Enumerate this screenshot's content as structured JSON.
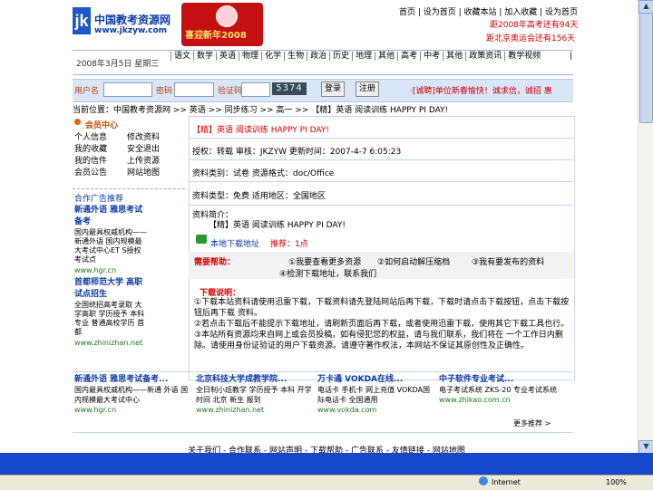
{
  "header": {
    "logo_mark": "jk",
    "logo_cn": "中国教考资源网",
    "logo_url": "www.jkzyw.com",
    "banner_text": "喜迎新年2008",
    "top_links": "首页 | 设为首页 | 收藏本站 | 加入收藏 | 设为首页",
    "countdown_1": "距2008年高考还有94天",
    "countdown_2": "距北京奥运会还有156天"
  },
  "nav": {
    "date": "2008年3月5日 星期三",
    "row1": [
      "语文",
      "数学",
      "英语",
      "物理",
      "化学",
      "生物",
      "政治",
      "历史",
      "地理",
      "其他",
      "高考",
      "中考",
      "其他",
      "政策资讯",
      "教学视频"
    ],
    "row2_tail": "|"
  },
  "login": {
    "user_label": "用户名",
    "pass_label": "密码",
    "code_label": "验证码",
    "captcha": "5374",
    "login_btn": "登录",
    "register_btn": "注册",
    "promo": "·[诚聘]单位新春愉快！诚求信，诚招 惠"
  },
  "breadcrumb": "当前位置：中国教考资源网 >> 英语 >> 同步练习 >> 高一 >> 【精】英语 阅读训练 HAPPY PI DAY!",
  "sidebar": {
    "title": "会员中心",
    "grid": [
      [
        "个人信息",
        "修改资料"
      ],
      [
        "我的收藏",
        "安全退出"
      ],
      [
        "我的信件",
        "上传资源"
      ],
      [
        "会员公告",
        "网站地图"
      ]
    ],
    "sub_header": "合作广告推荐",
    "ad1_title": "新通外语 雅思考试备考",
    "ad1_body": "国内最具权威机构——新通外语 国内规模最大考试中心ET S授权考试点",
    "ad1_url": "www.hgr.cn",
    "ad2_title": "首都师范大学 高职 试点招生",
    "ad2_body": "全国统招高考录取 大学高职 学历授予 本科 专业 普通高校学历 首都",
    "ad2_url": "www.zhinizhan.net"
  },
  "article": {
    "title": "【精】英语 阅读训练 HAPPY PI DAY!",
    "meta_line1": "授权：转载    审核：JKZYW    更新时间：2007-4-7 6:05:23",
    "meta_line2": "资料类别：试卷    资源格式：doc/Office",
    "meta_line3": "资料类型：免费    适用地区：全国地区",
    "desc_label": "资料简介：",
    "desc_text": "【精】英语 阅读训练 HAPPY PI DAY!",
    "download_label": "本地下载地址",
    "download_rate": "推荐：1点",
    "help_label": "需要帮助：",
    "help_1": "①我要查看更多资源",
    "help_2": "②如何启动解压缩档",
    "help_3": "③我有要发布的资料",
    "help_4": "④检测下载地址，联系我们",
    "explain_title": "下载说明：",
    "explain_1": "①下载本站资料请使用迅雷下载，下载资料请先登陆网站后再下载，下载时请点击下载按钮，点击下载按钮后再下载 资料。",
    "explain_2": "②若点击下载后不能提示下载地址，请刷新页面后再下载，或者使用迅雷下载，使用其它下载工具也行。",
    "explain_3": "③本站所有资源均来自网上或会员投稿，如有侵犯您的权益，请与我们联系，我们将在 一个工作日内删除。请使用身份证验证的用户下载资源。请遵守著作权法，本网站不保证其原创性及正确性。"
  },
  "ads": [
    {
      "title": "新通外语 雅思考试备考...",
      "body": "国内最具权威机构——新通 外语 国内规模最大考试中心",
      "url": "www.hgr.cn"
    },
    {
      "title": "北京科技大学成教学院...",
      "body": "全日制小班教学 学历授予 本科 开学时间 北京 新生 报到",
      "url": "www.zhinizhan.net"
    },
    {
      "title": "万卡通 VOKDA在线...",
      "body": "电话卡 手机卡 网上充值 VOKDA国际电话卡 全国通用",
      "url": "www.vokda.com"
    },
    {
      "title": "中子软件专业考试...",
      "body": "电子考试系统 ZKS-20 专业考试系统",
      "url": "www.zhikao.com.cn"
    }
  ],
  "ads_more": "更多推荐 >",
  "footer": "关于我们 - 合作联系 - 网站声明 - 下载帮助 - 广告联系 - 友情链接 - 网站地图",
  "statusbar": {
    "zone": "Internet",
    "zoom": "100%"
  }
}
